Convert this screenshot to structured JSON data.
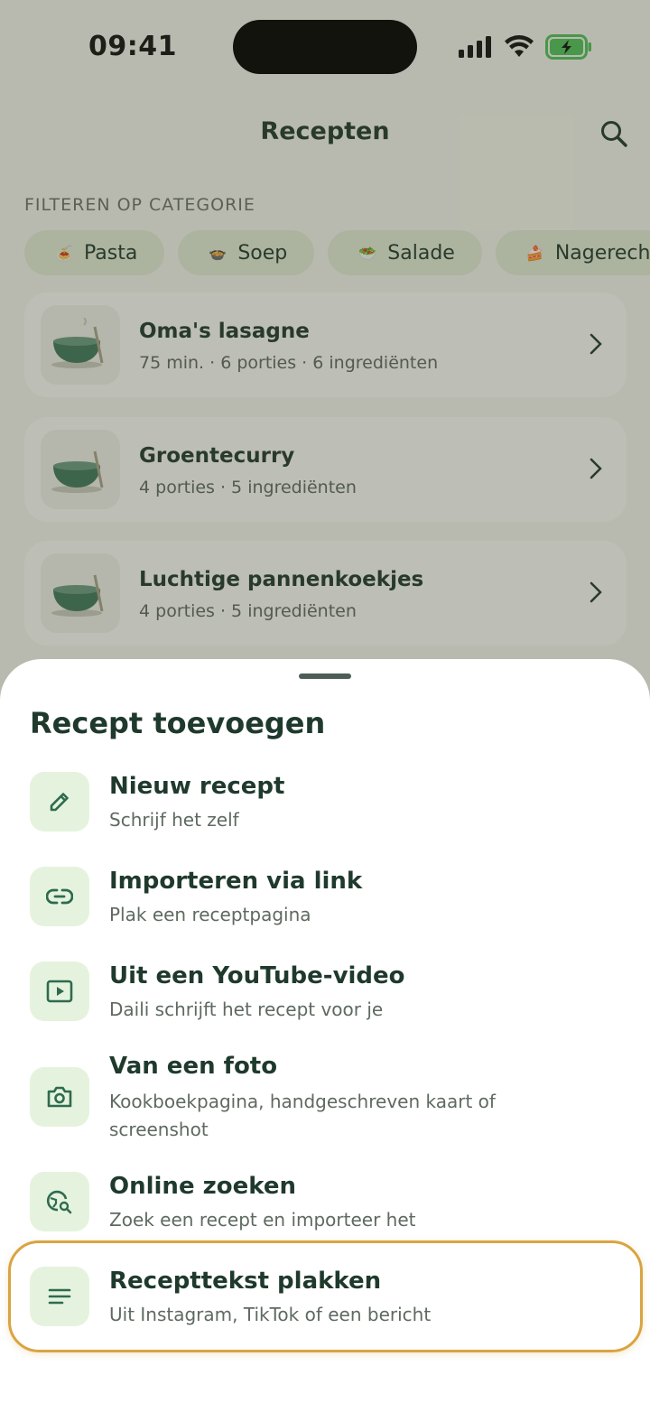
{
  "status_bar": {
    "time": "09:41"
  },
  "header": {
    "title": "Recepten"
  },
  "filters": {
    "label": "FILTEREN OP CATEGORIE",
    "chips": [
      {
        "label": "Pasta",
        "emoji": "🍝"
      },
      {
        "label": "Soep",
        "emoji": "🍲"
      },
      {
        "label": "Salade",
        "emoji": "🥗"
      },
      {
        "label": "Nagerecht",
        "emoji": "🍰"
      }
    ]
  },
  "recipes": [
    {
      "title": "Oma's lasagne",
      "meta": "75 min. · 6 porties · 6 ingrediënten"
    },
    {
      "title": "Groentecurry",
      "meta": "4 porties · 5 ingrediënten"
    },
    {
      "title": "Luchtige pannenkoekjes",
      "meta": "4 porties · 5 ingrediënten"
    }
  ],
  "sheet": {
    "title": "Recept toevoegen",
    "options": [
      {
        "label": "Nieuw recept",
        "sub": "Schrijf het zelf",
        "icon": "pencil-icon"
      },
      {
        "label": "Importeren via link",
        "sub": "Plak een receptpagina",
        "icon": "link-icon"
      },
      {
        "label": "Uit een YouTube-video",
        "sub": "Daili schrijft het recept voor je",
        "icon": "play-icon"
      },
      {
        "label": "Van een foto",
        "sub": "Kookboekpagina, handgeschreven kaart of screenshot",
        "icon": "camera-icon"
      },
      {
        "label": "Online zoeken",
        "sub": "Zoek een recept en importeer het",
        "icon": "globe-search-icon"
      },
      {
        "label": "Recepttekst plakken",
        "sub": "Uit Instagram, TikTok of een bericht",
        "icon": "text-lines-icon"
      }
    ]
  },
  "colors": {
    "accent_green": "#2e6b4f",
    "icon_bg": "#e5f3de",
    "highlight": "#d9a441"
  }
}
